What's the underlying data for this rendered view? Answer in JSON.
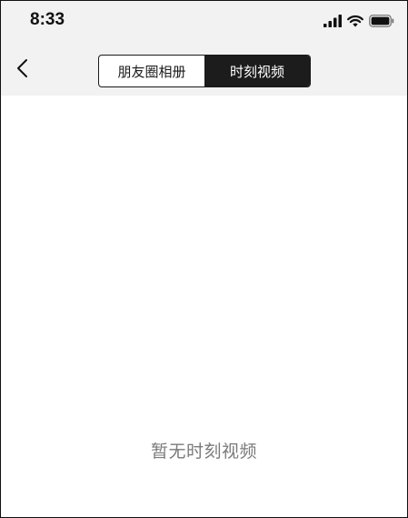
{
  "status_bar": {
    "time": "8:33",
    "icons": [
      "cellular-signal-icon",
      "wifi-icon",
      "battery-icon"
    ]
  },
  "nav": {
    "back_icon": "chevron-left-icon",
    "segments": [
      {
        "label": "朋友圈相册",
        "active": false
      },
      {
        "label": "时刻视频",
        "active": true
      }
    ]
  },
  "content": {
    "empty_message": "暂无时刻视频"
  },
  "colors": {
    "header_background": "#f2f2f2",
    "segment_active_background": "#1c1c1c",
    "segment_active_text": "#ffffff",
    "empty_text": "#7a7a7a"
  }
}
